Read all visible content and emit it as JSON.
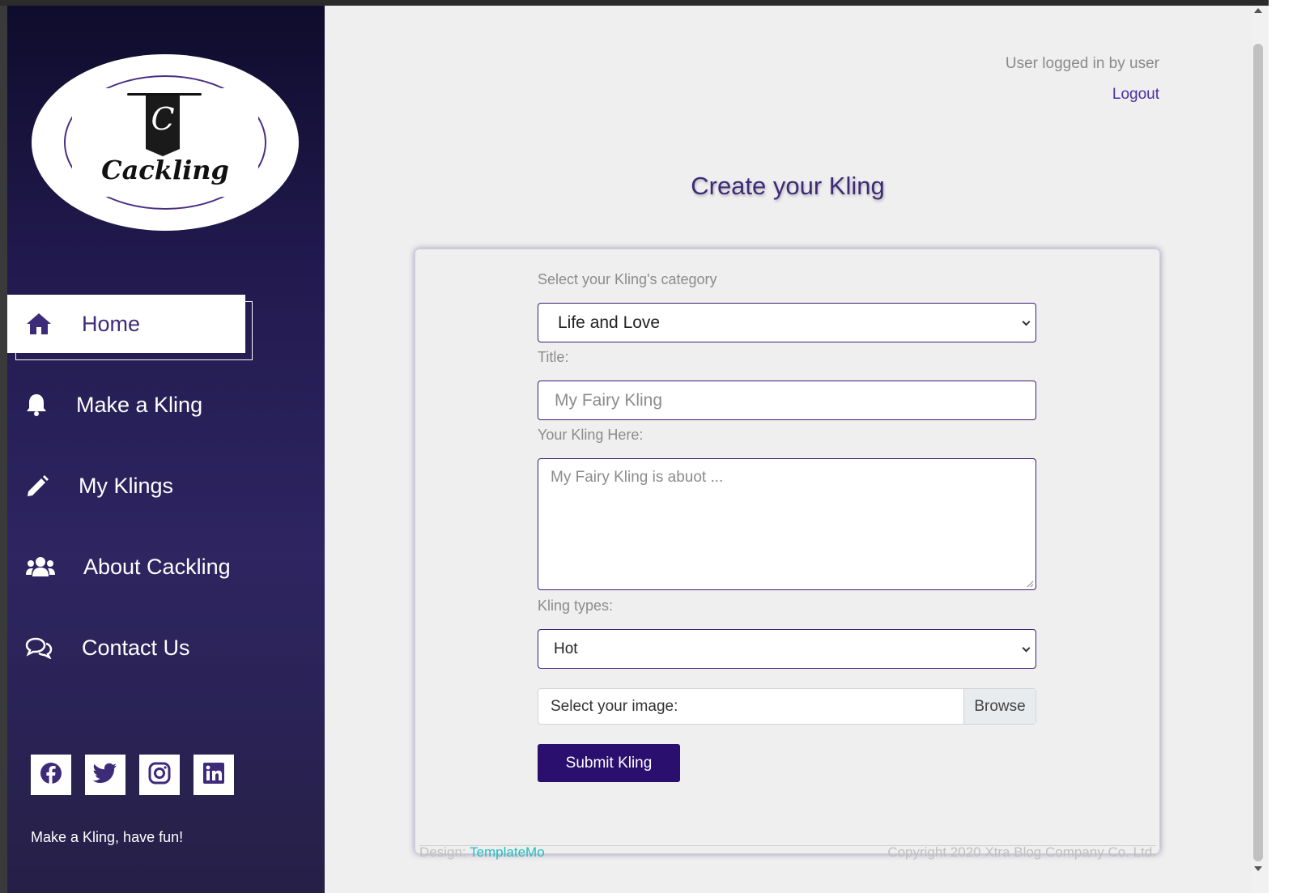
{
  "sidebar": {
    "logo_letter": "C",
    "logo_text": "Cackling",
    "nav": [
      {
        "label": "Home",
        "icon": "home-icon",
        "active": true
      },
      {
        "label": "Make a Kling",
        "icon": "bell-icon",
        "active": false
      },
      {
        "label": "My Klings",
        "icon": "pencil-icon",
        "active": false
      },
      {
        "label": "About Cackling",
        "icon": "users-icon",
        "active": false
      },
      {
        "label": "Contact Us",
        "icon": "comments-icon",
        "active": false
      }
    ],
    "social": [
      "facebook-icon",
      "twitter-icon",
      "instagram-icon",
      "linkedin-icon"
    ],
    "tagline": "Make a Kling, have fun!"
  },
  "header": {
    "user_status": "User logged in by user",
    "logout_label": "Logout"
  },
  "main": {
    "heading": "Create your Kling",
    "form": {
      "category_label": "Select your Kling's category",
      "category_value": "Life and Love",
      "title_label": "Title:",
      "title_placeholder": "My Fairy Kling",
      "body_label": "Your Kling Here:",
      "body_placeholder": "My Fairy Kling is abuot ...",
      "type_label": "Kling types:",
      "type_value": "Hot",
      "image_label": "Select your image:",
      "browse_label": "Browse",
      "submit_label": "Submit Kling"
    }
  },
  "footer": {
    "design_prefix": "Design: ",
    "design_link": "TemplateMo",
    "copyright": "Copyright 2020 Xtra Blog Company Co. Ltd."
  },
  "colors": {
    "accent": "#3d2b7a",
    "button": "#2a0f6e",
    "sidebar_top": "#0f0c2c",
    "sidebar_bottom": "#2e2561",
    "link": "#22c0c0"
  }
}
